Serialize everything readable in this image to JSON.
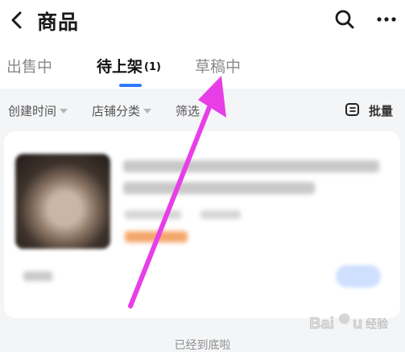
{
  "header": {
    "title": "商品",
    "back_icon": "chevron-left-icon",
    "search_icon": "search-icon",
    "more_icon": "more-dots-icon"
  },
  "tabs": [
    {
      "label": "出售中",
      "active": false
    },
    {
      "label": "待上架",
      "count": "(1)",
      "active": true
    },
    {
      "label": "草稿中",
      "active": false
    }
  ],
  "filters": {
    "created_time": "创建时间",
    "store_category": "店铺分类",
    "filter": "筛选",
    "batch": "批量",
    "batch_icon": "batch-edit-icon"
  },
  "list": {
    "end_text": "已经到底啦"
  },
  "colors": {
    "accent": "#2f7bff",
    "annotation_arrow": "#e83ee8",
    "price_blur": "#f3a66a"
  },
  "watermark": {
    "brand": "Baidu 经验"
  }
}
